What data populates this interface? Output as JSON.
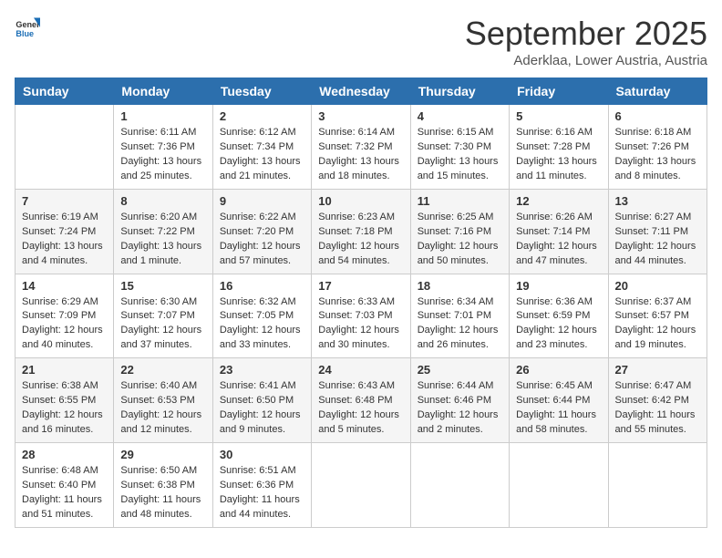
{
  "logo": {
    "general": "General",
    "blue": "Blue"
  },
  "header": {
    "month": "September 2025",
    "location": "Aderklaa, Lower Austria, Austria"
  },
  "days_of_week": [
    "Sunday",
    "Monday",
    "Tuesday",
    "Wednesday",
    "Thursday",
    "Friday",
    "Saturday"
  ],
  "weeks": [
    [
      {
        "day": "",
        "info": ""
      },
      {
        "day": "1",
        "info": "Sunrise: 6:11 AM\nSunset: 7:36 PM\nDaylight: 13 hours and 25 minutes."
      },
      {
        "day": "2",
        "info": "Sunrise: 6:12 AM\nSunset: 7:34 PM\nDaylight: 13 hours and 21 minutes."
      },
      {
        "day": "3",
        "info": "Sunrise: 6:14 AM\nSunset: 7:32 PM\nDaylight: 13 hours and 18 minutes."
      },
      {
        "day": "4",
        "info": "Sunrise: 6:15 AM\nSunset: 7:30 PM\nDaylight: 13 hours and 15 minutes."
      },
      {
        "day": "5",
        "info": "Sunrise: 6:16 AM\nSunset: 7:28 PM\nDaylight: 13 hours and 11 minutes."
      },
      {
        "day": "6",
        "info": "Sunrise: 6:18 AM\nSunset: 7:26 PM\nDaylight: 13 hours and 8 minutes."
      }
    ],
    [
      {
        "day": "7",
        "info": "Sunrise: 6:19 AM\nSunset: 7:24 PM\nDaylight: 13 hours and 4 minutes."
      },
      {
        "day": "8",
        "info": "Sunrise: 6:20 AM\nSunset: 7:22 PM\nDaylight: 13 hours and 1 minute."
      },
      {
        "day": "9",
        "info": "Sunrise: 6:22 AM\nSunset: 7:20 PM\nDaylight: 12 hours and 57 minutes."
      },
      {
        "day": "10",
        "info": "Sunrise: 6:23 AM\nSunset: 7:18 PM\nDaylight: 12 hours and 54 minutes."
      },
      {
        "day": "11",
        "info": "Sunrise: 6:25 AM\nSunset: 7:16 PM\nDaylight: 12 hours and 50 minutes."
      },
      {
        "day": "12",
        "info": "Sunrise: 6:26 AM\nSunset: 7:14 PM\nDaylight: 12 hours and 47 minutes."
      },
      {
        "day": "13",
        "info": "Sunrise: 6:27 AM\nSunset: 7:11 PM\nDaylight: 12 hours and 44 minutes."
      }
    ],
    [
      {
        "day": "14",
        "info": "Sunrise: 6:29 AM\nSunset: 7:09 PM\nDaylight: 12 hours and 40 minutes."
      },
      {
        "day": "15",
        "info": "Sunrise: 6:30 AM\nSunset: 7:07 PM\nDaylight: 12 hours and 37 minutes."
      },
      {
        "day": "16",
        "info": "Sunrise: 6:32 AM\nSunset: 7:05 PM\nDaylight: 12 hours and 33 minutes."
      },
      {
        "day": "17",
        "info": "Sunrise: 6:33 AM\nSunset: 7:03 PM\nDaylight: 12 hours and 30 minutes."
      },
      {
        "day": "18",
        "info": "Sunrise: 6:34 AM\nSunset: 7:01 PM\nDaylight: 12 hours and 26 minutes."
      },
      {
        "day": "19",
        "info": "Sunrise: 6:36 AM\nSunset: 6:59 PM\nDaylight: 12 hours and 23 minutes."
      },
      {
        "day": "20",
        "info": "Sunrise: 6:37 AM\nSunset: 6:57 PM\nDaylight: 12 hours and 19 minutes."
      }
    ],
    [
      {
        "day": "21",
        "info": "Sunrise: 6:38 AM\nSunset: 6:55 PM\nDaylight: 12 hours and 16 minutes."
      },
      {
        "day": "22",
        "info": "Sunrise: 6:40 AM\nSunset: 6:53 PM\nDaylight: 12 hours and 12 minutes."
      },
      {
        "day": "23",
        "info": "Sunrise: 6:41 AM\nSunset: 6:50 PM\nDaylight: 12 hours and 9 minutes."
      },
      {
        "day": "24",
        "info": "Sunrise: 6:43 AM\nSunset: 6:48 PM\nDaylight: 12 hours and 5 minutes."
      },
      {
        "day": "25",
        "info": "Sunrise: 6:44 AM\nSunset: 6:46 PM\nDaylight: 12 hours and 2 minutes."
      },
      {
        "day": "26",
        "info": "Sunrise: 6:45 AM\nSunset: 6:44 PM\nDaylight: 11 hours and 58 minutes."
      },
      {
        "day": "27",
        "info": "Sunrise: 6:47 AM\nSunset: 6:42 PM\nDaylight: 11 hours and 55 minutes."
      }
    ],
    [
      {
        "day": "28",
        "info": "Sunrise: 6:48 AM\nSunset: 6:40 PM\nDaylight: 11 hours and 51 minutes."
      },
      {
        "day": "29",
        "info": "Sunrise: 6:50 AM\nSunset: 6:38 PM\nDaylight: 11 hours and 48 minutes."
      },
      {
        "day": "30",
        "info": "Sunrise: 6:51 AM\nSunset: 6:36 PM\nDaylight: 11 hours and 44 minutes."
      },
      {
        "day": "",
        "info": ""
      },
      {
        "day": "",
        "info": ""
      },
      {
        "day": "",
        "info": ""
      },
      {
        "day": "",
        "info": ""
      }
    ]
  ]
}
